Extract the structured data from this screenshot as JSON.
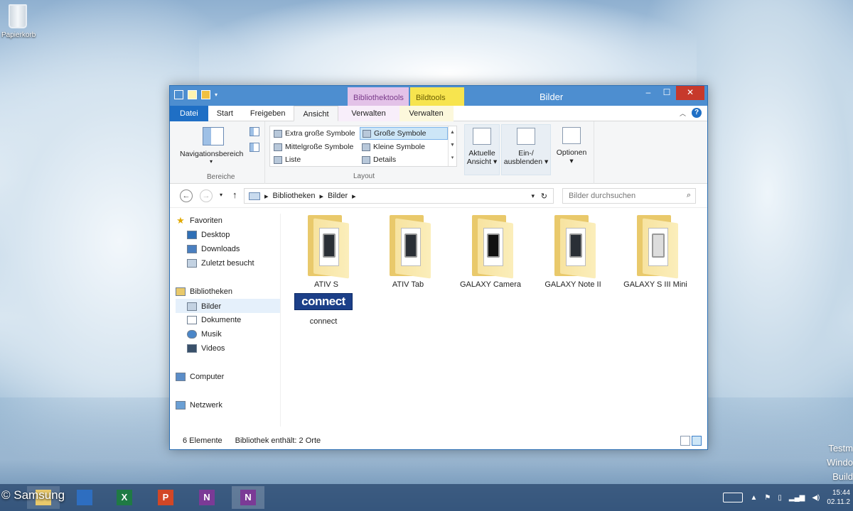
{
  "desktop": {
    "recycle_bin_label": "Papierkorb",
    "watermark_lines": [
      "Testm",
      "Windo",
      "Build"
    ],
    "copyright": "© Samsung"
  },
  "window": {
    "title": "Bilder",
    "context_tabs": [
      "Bibliothektools",
      "Bildtools"
    ],
    "tabs": {
      "file": "Datei",
      "start": "Start",
      "share": "Freigeben",
      "view": "Ansicht",
      "manage1": "Verwalten",
      "manage2": "Verwalten"
    },
    "buttons": {
      "minimize": "–",
      "maximize": "☐",
      "close": "✕"
    },
    "help": "?"
  },
  "ribbon": {
    "nav_pane": "Navigationsbereich",
    "group_panes": "Bereiche",
    "layout_items": [
      "Extra große Symbole",
      "Große Symbole",
      "Mittelgroße Symbole",
      "Kleine Symbole",
      "Liste",
      "Details"
    ],
    "group_layout": "Layout",
    "current_view_line1": "Aktuelle",
    "current_view_line2": "Ansicht ▾",
    "show_hide_line1": "Ein-/",
    "show_hide_line2": "ausblenden ▾",
    "options": "Optionen",
    "options_arrow": "▾"
  },
  "address": {
    "crumbs": [
      "Bibliotheken",
      "Bilder"
    ],
    "sep": "▸",
    "search_placeholder": "Bilder durchsuchen"
  },
  "nav": {
    "favorites": "Favoriten",
    "desktop": "Desktop",
    "downloads": "Downloads",
    "recent": "Zuletzt besucht",
    "libraries": "Bibliotheken",
    "pictures": "Bilder",
    "documents": "Dokumente",
    "music": "Musik",
    "videos": "Videos",
    "computer": "Computer",
    "network": "Netzwerk"
  },
  "files": [
    {
      "name": "ATIV S"
    },
    {
      "name": "ATIV Tab"
    },
    {
      "name": "GALAXY Camera"
    },
    {
      "name": "GALAXY Note II"
    },
    {
      "name": "GALAXY S III Mini"
    },
    {
      "name": "connect",
      "logo_text": "connect"
    }
  ],
  "status": {
    "count": "6 Elemente",
    "info": "Bibliothek enthält: 2 Orte"
  },
  "taskbar": {
    "apps": [
      "X",
      "P",
      "N",
      "N"
    ],
    "clock_time": "15:44",
    "clock_date": "02.11.2"
  }
}
